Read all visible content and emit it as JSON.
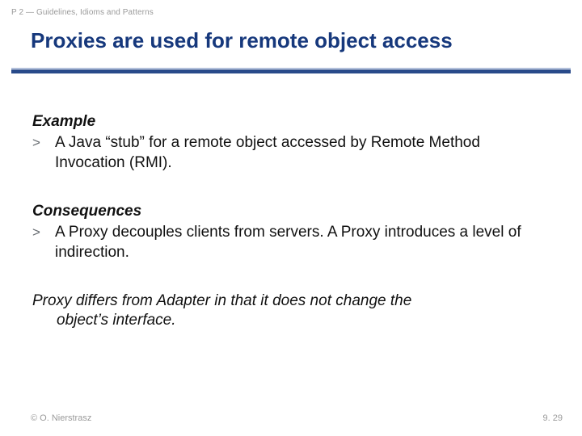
{
  "breadcrumb": "P 2 — Guidelines, Idioms and Patterns",
  "title": "Proxies are used for remote object access",
  "sections": {
    "example": {
      "heading": "Example",
      "bullet_marker": ">",
      "bullet_text": "A Java “stub” for a remote object accessed by Remote Method Invocation (RMI)."
    },
    "consequences": {
      "heading": "Consequences",
      "bullet_marker": ">",
      "bullet_text": "A Proxy decouples clients from servers. A Proxy introduces a level of indirection."
    },
    "closing": {
      "line1": "Proxy differs from Adapter in that it does not change the",
      "line2": "object’s interface."
    }
  },
  "footer": {
    "copyright": "© O. Nierstrasz",
    "page": "9. 29"
  }
}
